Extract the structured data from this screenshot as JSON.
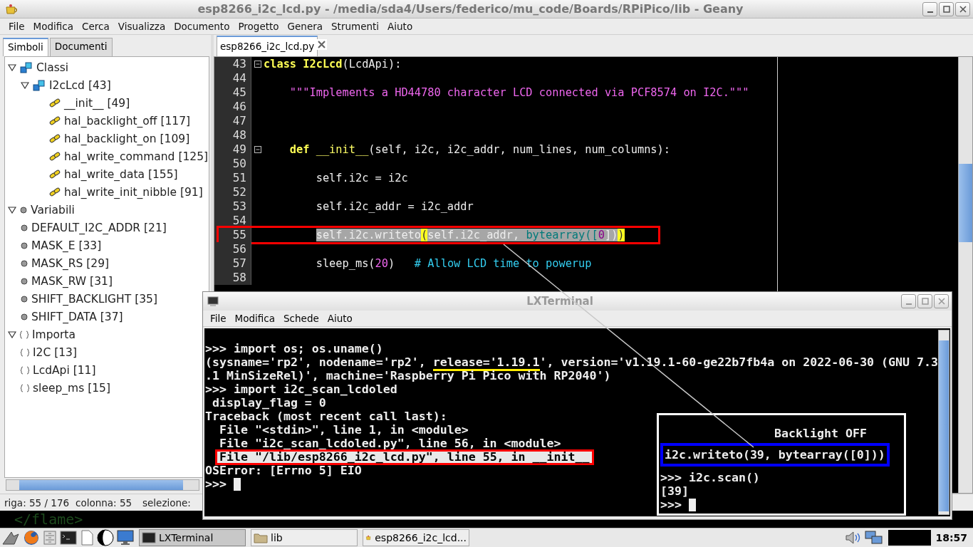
{
  "window": {
    "title": "esp8266_i2c_lcd.py - /media/sda4/Users/federico/mu_code/Boards/RPiPico/lib - Geany"
  },
  "menu": [
    "File",
    "Modifica",
    "Cerca",
    "Visualizza",
    "Documento",
    "Progetto",
    "Genera",
    "Strumenti",
    "Aiuto"
  ],
  "sidebar": {
    "tabs": [
      {
        "label": "Simboli",
        "selected": true
      },
      {
        "label": "Documenti",
        "selected": false
      }
    ],
    "tree": [
      {
        "label": "Classi",
        "kind": "class",
        "expanded": true,
        "children": [
          {
            "label": "I2cLcd [43]",
            "kind": "class",
            "expanded": true,
            "children": [
              {
                "label": "__init__ [49]",
                "kind": "method"
              },
              {
                "label": "hal_backlight_off [117]",
                "kind": "method"
              },
              {
                "label": "hal_backlight_on [109]",
                "kind": "method"
              },
              {
                "label": "hal_write_command [125]",
                "kind": "method"
              },
              {
                "label": "hal_write_data [155]",
                "kind": "method"
              },
              {
                "label": "hal_write_init_nibble [91]",
                "kind": "method"
              }
            ]
          }
        ]
      },
      {
        "label": "Variabili",
        "kind": "variable",
        "expanded": true,
        "children": [
          {
            "label": "DEFAULT_I2C_ADDR [21]",
            "kind": "variable"
          },
          {
            "label": "MASK_E [33]",
            "kind": "variable"
          },
          {
            "label": "MASK_RS [29]",
            "kind": "variable"
          },
          {
            "label": "MASK_RW [31]",
            "kind": "variable"
          },
          {
            "label": "SHIFT_BACKLIGHT [35]",
            "kind": "variable"
          },
          {
            "label": "SHIFT_DATA [37]",
            "kind": "variable"
          }
        ]
      },
      {
        "label": "Importa",
        "kind": "import",
        "expanded": true,
        "children": [
          {
            "label": "I2C [13]",
            "kind": "import"
          },
          {
            "label": "LcdApi [11]",
            "kind": "import"
          },
          {
            "label": "sleep_ms [15]",
            "kind": "import"
          }
        ]
      }
    ]
  },
  "editor": {
    "tab": "esp8266_i2c_lcd.py",
    "lines": [
      {
        "num": "43",
        "fold": true,
        "tokens": [
          {
            "text": "class",
            "kind": "kw"
          },
          {
            "text": "I2cLcd",
            "kind": "kw"
          },
          {
            "text": "(LcdApi):",
            "kind": "plain"
          }
        ],
        "children": [
          {
            "num": "44"
          },
          {
            "num": "45",
            "tokens": [
              {
                "text": "\"\"\"Implements a HD44780 character LCD connected via PCF8574 on I2C.\"\"\"",
                "kind": "str"
              }
            ]
          },
          {
            "num": "46"
          },
          {
            "num": "47"
          },
          {
            "num": "48"
          },
          {
            "num": "49",
            "fold": true,
            "tokens": [
              {
                "text": "def",
                "kind": "kw"
              },
              {
                "text": "__init__",
                "kind": "fn"
              },
              {
                "text": "(self, i2c, i2c_addr, num_lines, num_columns):",
                "kind": "plain"
              }
            ],
            "children": [
              {
                "num": "50"
              },
              {
                "num": "51",
                "tokens": [
                  {
                    "text": "self.i2c = i2c",
                    "kind": "plain"
                  }
                ]
              },
              {
                "num": "52"
              },
              {
                "num": "53",
                "tokens": [
                  {
                    "text": "self.i2c_addr = i2c_addr",
                    "kind": "plain"
                  }
                ]
              },
              {
                "num": "54"
              },
              {
                "num": "55",
                "selection": true,
                "framed": true,
                "tokens": [
                  {
                    "text": "self.i2c.writeto",
                    "kind": "plain"
                  },
                  {
                    "text": "(",
                    "kind": "brace"
                  },
                  {
                    "text": "self.i2c_addr,",
                    "kind": "plain"
                  },
                  {
                    "text": "bytearray([",
                    "kind": "builtin"
                  },
                  {
                    "text": "0",
                    "kind": "num"
                  },
                  {
                    "text": "])",
                    "kind": "plain"
                  },
                  {
                    "text": ")",
                    "kind": "brace"
                  }
                ]
              },
              {
                "num": "56"
              },
              {
                "num": "57",
                "tokens": [
                  {
                    "text": "sleep_ms(",
                    "kind": "plain"
                  },
                  {
                    "text": "20",
                    "kind": "num"
                  },
                  {
                    "text": ")",
                    "kind": "plain"
                  },
                  {
                    "text": "# Allow LCD time to powerup",
                    "kind": "comment"
                  }
                ]
              },
              {
                "num": "58"
              }
            ]
          }
        ]
      }
    ]
  },
  "status_bar": [
    "riga: 55 / 176",
    "colonna: 55",
    "selezione:"
  ],
  "desktop": {
    "text": "</flame>"
  },
  "terminal": {
    "title": "LXTerminal",
    "menu": [
      "File",
      "Modifica",
      "Schede",
      "Aiuto"
    ],
    "lines": [
      {
        "kind": "plain",
        "text": ">>> import os; os.uname()"
      },
      {
        "kind": "plain",
        "segments": [
          {
            "text": "(sysname='rp2', nodename='rp2', "
          },
          {
            "text": "release='1.19.1",
            "underlined": true
          },
          {
            "text": "', version='v1.19.1-60-ge22b7fb4a on 2022-06-30 (GNU 7.3"
          }
        ]
      },
      {
        "kind": "plain",
        "text": ".1 MinSizeRel)', machine='Raspberry Pi Pico with RP2040')"
      },
      {
        "kind": "plain",
        "text": ">>> import i2c_scan_lcdoled"
      },
      {
        "kind": "plain",
        "text": " display_flag = 0"
      },
      {
        "kind": "plain",
        "text": "Traceback (most recent call last):"
      },
      {
        "kind": "plain",
        "text": "  File \"<stdin>\", line 1, in <module>"
      },
      {
        "kind": "plain",
        "text": "  File \"i2c_scan_lcdoled.py\", line 56, in <module>"
      },
      {
        "kind": "framed",
        "text": "File \"/lib/esp8266_i2c_lcd.py\", line 55, in __init__"
      },
      {
        "kind": "plain",
        "text": "OSError: [Errno 5] EIO"
      },
      {
        "kind": "prompt",
        "text": ">>>"
      }
    ],
    "inset": {
      "heading": "Backlight OFF",
      "framed": "i2c.writeto(39, bytearray([0]))",
      "lines": [
        {
          "kind": "plain",
          "text": ">>> i2c.scan()"
        },
        {
          "kind": "plain",
          "text": "[39]"
        },
        {
          "kind": "prompt",
          "text": ">>>"
        }
      ]
    }
  },
  "taskbar": {
    "tasks": [
      {
        "label": "LXTerminal",
        "selected": true
      },
      {
        "label": "lib",
        "selected": false
      },
      {
        "label": "esp8266_i2c_lcd...",
        "selected": false
      }
    ],
    "clock": "18:57"
  }
}
